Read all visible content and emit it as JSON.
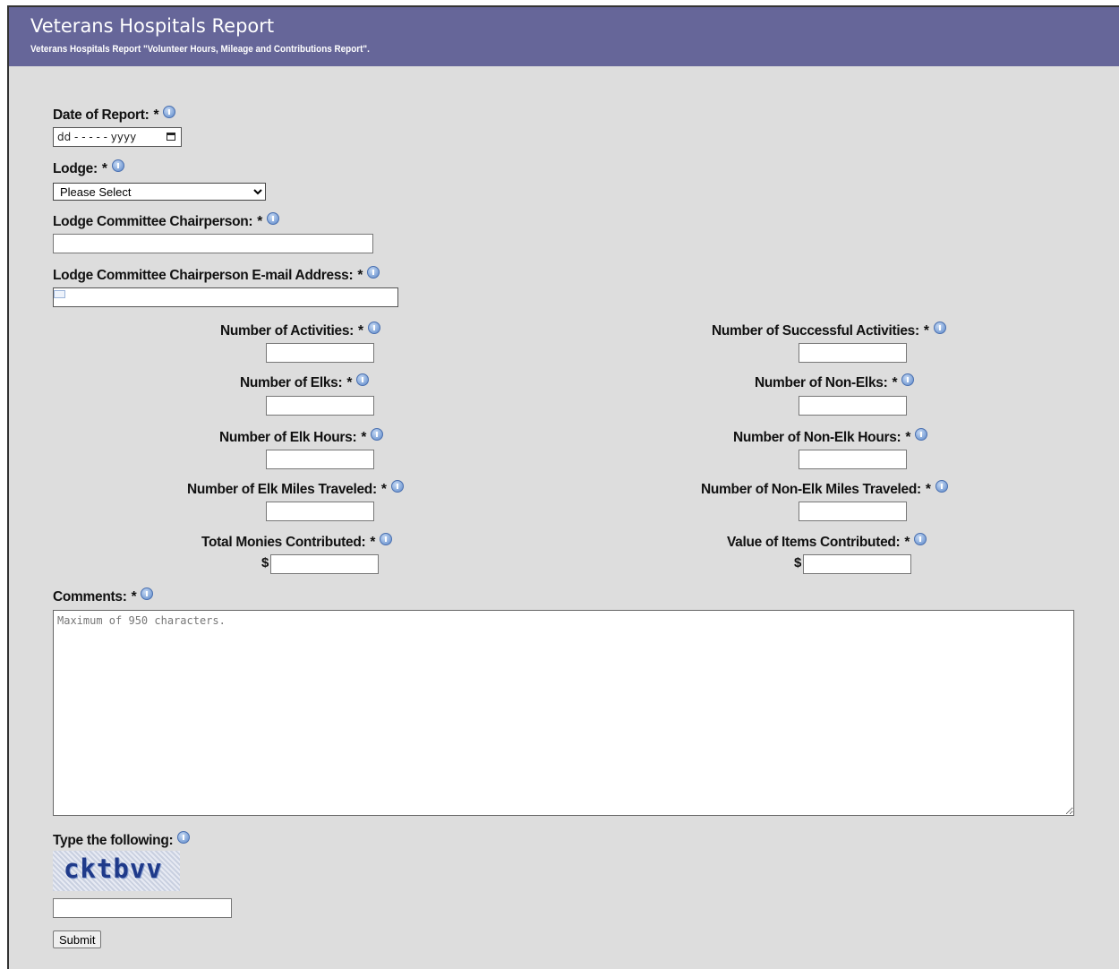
{
  "header": {
    "title": "Veterans Hospitals Report",
    "subtitle": "Veterans Hospitals Report \"Volunteer Hours, Mileage and Contributions Report\"."
  },
  "icons": {
    "info": "info-icon",
    "email": "envelope-icon",
    "calendar": "calendar-icon"
  },
  "form": {
    "date_label": "Date of Report:",
    "date_value": "dd - - - - - yyyy",
    "lodge_label": "Lodge:",
    "lodge_selected": "Please Select",
    "chair_label": "Lodge Committee Chairperson:",
    "email_label": "Lodge Committee Chairperson E-mail Address:",
    "required_mark": "*",
    "activities_label": "Number of Activities:",
    "successful_label": "Number of Successful Activities:",
    "elks_label": "Number of Elks:",
    "nonelks_label": "Number of Non-Elks:",
    "elk_hours_label": "Number of Elk Hours:",
    "nonelk_hours_label": "Number of Non-Elk Hours:",
    "elk_miles_label": "Number of Elk Miles Traveled:",
    "nonelk_miles_label": "Number of Non-Elk Miles Traveled:",
    "monies_label": "Total Monies Contributed:",
    "items_label": "Value of Items Contributed:",
    "currency": "$",
    "comments_label": "Comments:",
    "comments_placeholder": "Maximum of 950 characters.",
    "captcha_label": "Type the following:",
    "captcha_text": "cktbvv",
    "submit_label": "Submit"
  },
  "colors": {
    "header_bg": "#666699",
    "page_bg": "#dddddd",
    "info_blue": "#5a86c8"
  }
}
